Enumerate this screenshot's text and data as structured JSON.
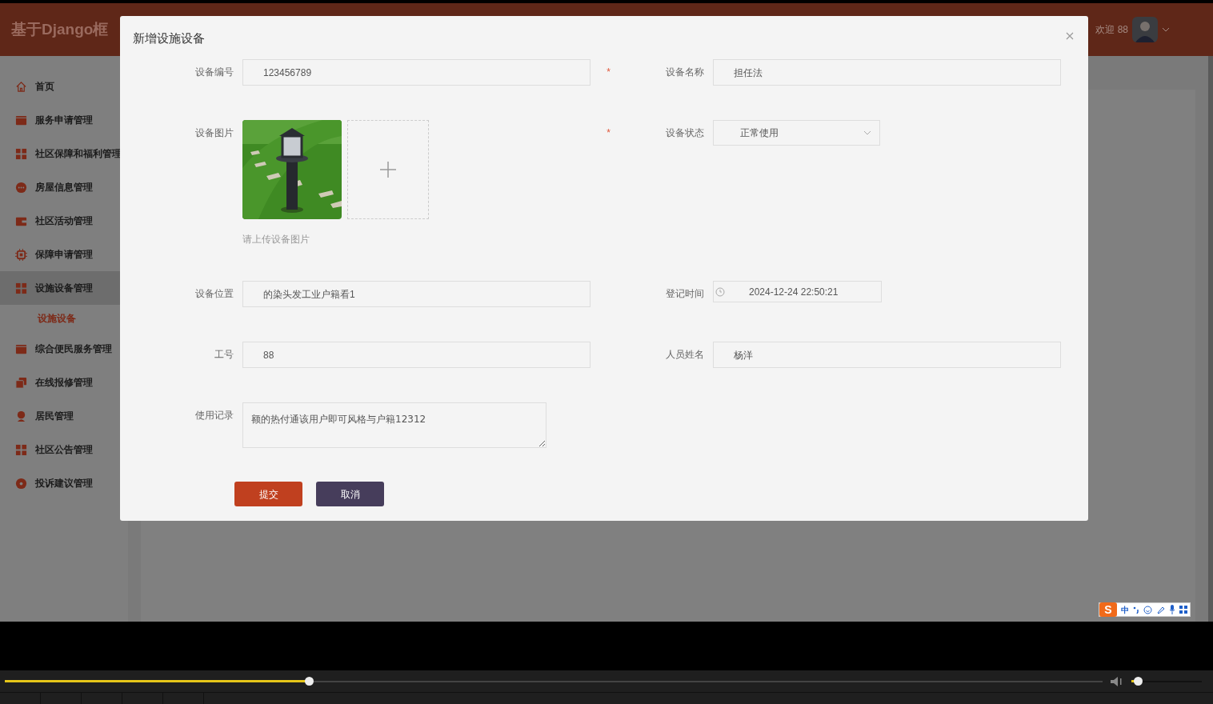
{
  "app": {
    "title": "基于Django框",
    "greeting": "欢迎 88"
  },
  "sidebar": {
    "items": [
      {
        "label": "首页",
        "selected": false
      },
      {
        "label": "服务申请管理",
        "selected": false
      },
      {
        "label": "社区保障和福利管理",
        "selected": false
      },
      {
        "label": "房屋信息管理",
        "selected": false
      },
      {
        "label": "社区活动管理",
        "selected": false
      },
      {
        "label": "保障申请管理",
        "selected": false
      },
      {
        "label": "设施设备管理",
        "selected": true,
        "children": [
          {
            "label": "设施设备",
            "selected": true
          }
        ]
      },
      {
        "label": "综合便民服务管理",
        "selected": false
      },
      {
        "label": "在线报修管理",
        "selected": false
      },
      {
        "label": "居民管理",
        "selected": false
      },
      {
        "label": "社区公告管理",
        "selected": false
      },
      {
        "label": "投诉建议管理",
        "selected": false
      }
    ]
  },
  "dialog": {
    "title": "新增设施设备",
    "fields": [
      {
        "label": "设备编号",
        "kind": "text",
        "value": "123456789"
      },
      {
        "label": "设备名称",
        "kind": "text",
        "required_mark": "*",
        "value": "担任法"
      },
      {
        "label": "设备图片",
        "hint": "请上传设备图片"
      },
      {
        "label": "设备状态",
        "kind": "select",
        "required_mark": "*",
        "value": "正常使用"
      },
      {
        "label": "设备位置",
        "kind": "text",
        "value": "的染头发工业户籍看1"
      },
      {
        "label": "登记时间",
        "kind": "datetime",
        "value": "2024-12-24 22:50:21"
      },
      {
        "label": "工号",
        "kind": "text",
        "value": "88"
      },
      {
        "label": "人员姓名",
        "kind": "text",
        "value": "杨洋"
      },
      {
        "label": "使用记录",
        "kind": "textarea",
        "value": "额的热付通该用户即可风格与户籍12312"
      }
    ],
    "buttons": [
      {
        "label": "提交",
        "kind": "primary"
      },
      {
        "label": "取消",
        "kind": "secondary"
      }
    ]
  },
  "ime": {
    "logo": "S",
    "mode": "中"
  },
  "player": {
    "progress": {
      "level": 0.277
    },
    "volume": {
      "level": 0.09
    }
  }
}
